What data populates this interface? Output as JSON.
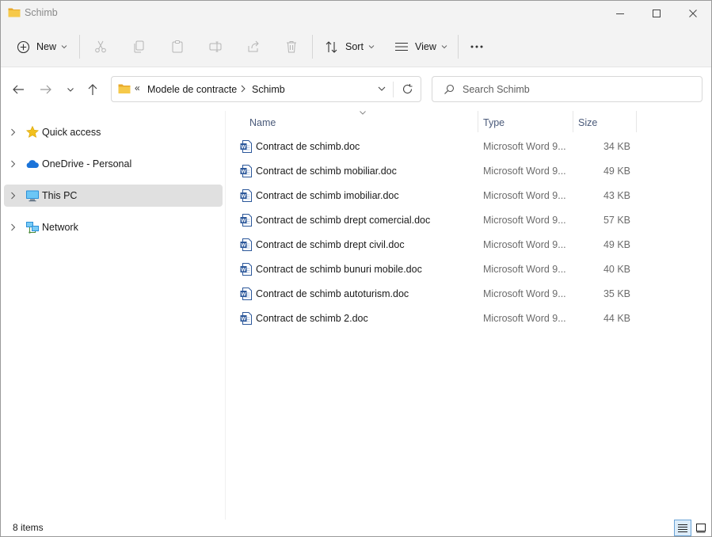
{
  "window": {
    "title": "Schimb"
  },
  "toolbar": {
    "new_label": "New",
    "sort_label": "Sort",
    "view_label": "View"
  },
  "address": {
    "segments": [
      "Modele de contracte",
      "Schimb"
    ]
  },
  "search": {
    "placeholder": "Search Schimb"
  },
  "sidebar": {
    "items": [
      {
        "label": "Quick access",
        "icon": "star-icon"
      },
      {
        "label": "OneDrive - Personal",
        "icon": "cloud-icon"
      },
      {
        "label": "This PC",
        "icon": "monitor-icon",
        "selected": true
      },
      {
        "label": "Network",
        "icon": "network-icon"
      }
    ]
  },
  "columns": {
    "name": "Name",
    "type": "Type",
    "size": "Size"
  },
  "files": [
    {
      "name": "Contract de schimb.doc",
      "type": "Microsoft Word 9...",
      "size": "34 KB"
    },
    {
      "name": "Contract de schimb mobiliar.doc",
      "type": "Microsoft Word 9...",
      "size": "49 KB"
    },
    {
      "name": "Contract de schimb imobiliar.doc",
      "type": "Microsoft Word 9...",
      "size": "43 KB"
    },
    {
      "name": "Contract de schimb drept comercial.doc",
      "type": "Microsoft Word 9...",
      "size": "57 KB"
    },
    {
      "name": "Contract de schimb drept civil.doc",
      "type": "Microsoft Word 9...",
      "size": "49 KB"
    },
    {
      "name": "Contract de schimb bunuri mobile.doc",
      "type": "Microsoft Word 9...",
      "size": "40 KB"
    },
    {
      "name": "Contract de schimb autoturism.doc",
      "type": "Microsoft Word 9...",
      "size": "35 KB"
    },
    {
      "name": "Contract de schimb 2.doc",
      "type": "Microsoft Word 9...",
      "size": "44 KB"
    }
  ],
  "status": {
    "item_count": "8 items"
  },
  "colors": {
    "folder": "#f4c542",
    "word_blue": "#2b579a",
    "selected_bg": "#e0e0e0",
    "header_text": "#4a5a7a"
  }
}
